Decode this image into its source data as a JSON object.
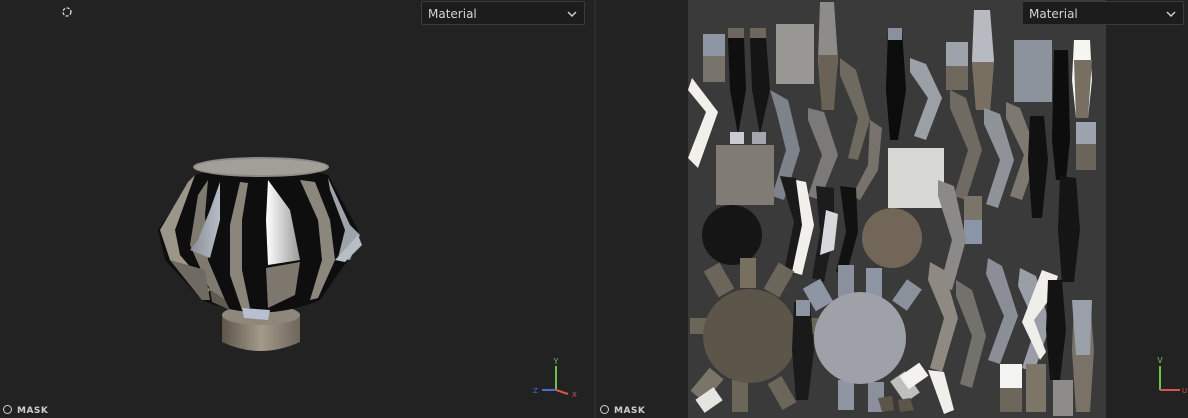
{
  "viewport_3d": {
    "channel_dropdown": {
      "value": "Material"
    },
    "mask_label": "MASK",
    "axes": {
      "x": "X",
      "y": "Y",
      "z": "Z"
    },
    "icons": [
      "frame-icon",
      "chevron-down-icon",
      "axis-gizmo-icon"
    ]
  },
  "viewport_2d": {
    "channel_dropdown": {
      "value": "Material"
    },
    "mask_label": "MASK",
    "axes": {
      "u": "U",
      "v": "V"
    },
    "icons": [
      "chevron-down-icon",
      "uv-axis-gizmo-icon"
    ]
  },
  "colors": {
    "background": "#222222",
    "uv_canvas": "#3a3a3a",
    "axis_x": "#d9534f",
    "axis_y": "#6cc24a",
    "axis_z": "#4a6cd9"
  }
}
